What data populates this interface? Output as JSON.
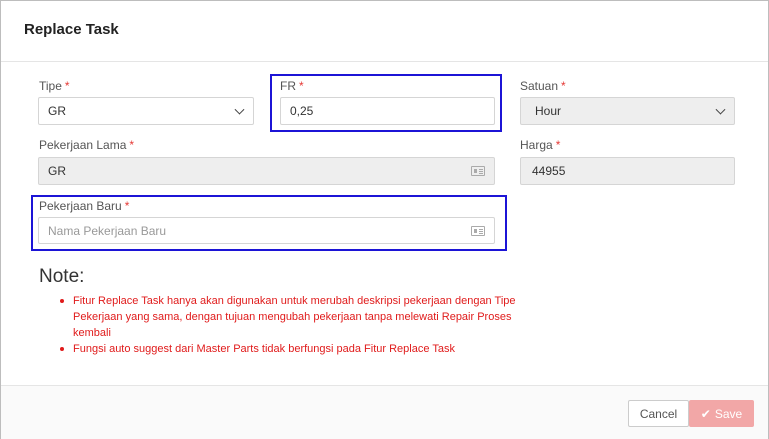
{
  "dialog": {
    "title": "Replace Task"
  },
  "form": {
    "tipe": {
      "label": "Tipe",
      "required": "*",
      "value": "GR"
    },
    "fr": {
      "label": "FR",
      "required": "*",
      "value": "0,25"
    },
    "satuan": {
      "label": "Satuan",
      "required": "*",
      "value": "Hour"
    },
    "pekerjaan_lama": {
      "label": "Pekerjaan Lama",
      "required": "*",
      "value": "GR"
    },
    "harga": {
      "label": "Harga",
      "required": "*",
      "value": "44955"
    },
    "pekerjaan_baru": {
      "label": "Pekerjaan Baru",
      "required": "*",
      "placeholder": "Nama Pekerjaan Baru"
    }
  },
  "note": {
    "title": "Note:",
    "items": [
      "Fitur Replace Task hanya akan digunakan untuk merubah deskripsi pekerjaan dengan Tipe Pekerjaan yang sama, dengan tujuan mengubah pekerjaan tanpa melewati Repair Proses kembali",
      "Fungsi auto suggest dari Master Parts tidak berfungsi pada Fitur Replace Task"
    ]
  },
  "footer": {
    "cancel_label": "Cancel",
    "save_label": "Save"
  },
  "colors": {
    "highlight": "#1c14d6",
    "note_text": "#e01b1b",
    "save_button": "#f2a7a7"
  }
}
